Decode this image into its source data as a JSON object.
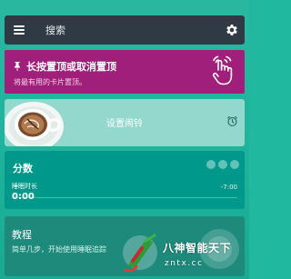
{
  "header": {
    "search_placeholder": "搜索"
  },
  "pin_card": {
    "title": "长按置顶或取消置顶",
    "description": "将最有用的卡片置顶。"
  },
  "alarm_card": {
    "label": "设置闹铃"
  },
  "score_card": {
    "title": "分数",
    "sleep_duration_label": "睡眠时长",
    "sleep_duration_value": "0:00",
    "target_delta": "-7:00",
    "progress_fraction": 0
  },
  "tutorial_card": {
    "title": "教程",
    "description": "简单几步，开始使用睡眠追踪"
  },
  "watermark": {
    "brand": "八神智能天下",
    "domain": "zntx.cc"
  },
  "colors": {
    "background": "#1fb59e",
    "search_bar": "#2f3a44",
    "pin_card": "#a01f7a",
    "alarm_card": "#93d7cd",
    "score_card": "#00988a",
    "tutorial_card": "#1d8a7c"
  },
  "icons": {
    "menu": "menu-icon",
    "settings": "gear-icon",
    "pin": "pin-icon",
    "gesture": "hand-tap-icon",
    "alarm": "alarm-clock-icon",
    "more": "dots-icon"
  }
}
